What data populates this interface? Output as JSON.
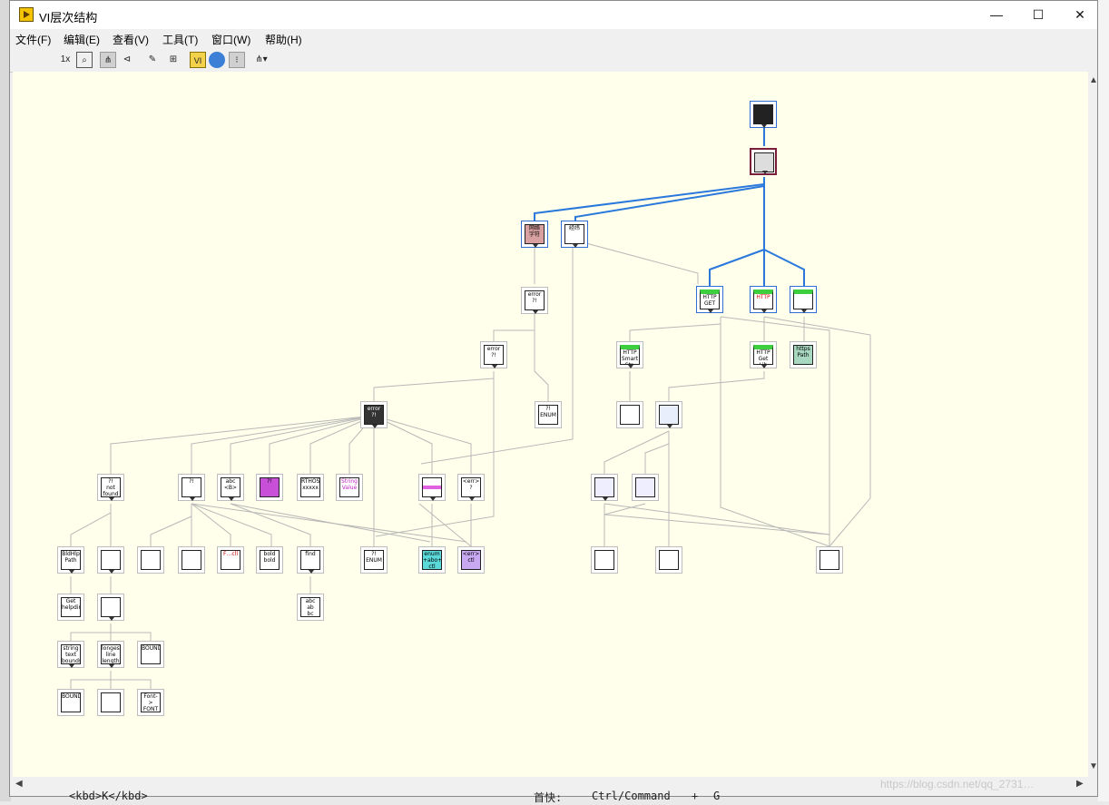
{
  "window": {
    "title": "VI层次结构",
    "controls": {
      "minimize": "—",
      "maximize": "☐",
      "close": "✕"
    }
  },
  "menu": [
    "文件(F)",
    "编辑(E)",
    "查看(V)",
    "工具(T)",
    "窗口(W)",
    "帮助(H)"
  ],
  "toolbar": {
    "zoom": "1x"
  },
  "nodes": {
    "n1": "",
    "n2": "",
    "n3": "网络\n字符",
    "n4": "经纬",
    "n5": "HTTP\nGET",
    "n6": "HTTP",
    "n7": "",
    "n8": "error\n?!",
    "n9": "error\n?!",
    "n10": "HTTP\nSmart\nStr->Pt",
    "n11": "HTTP\nGet\nLib",
    "n12": "https\nPath",
    "n13": "error\n?!",
    "n14": "?!\nENUM",
    "n15": "",
    "n16": "",
    "n17": "?!\nnot\nfound",
    "n18": "?!",
    "n19": "abc\n<B>",
    "n20": "?!",
    "n21": "RTHOST\nxxxxx",
    "n22": "String\nValue",
    "n23": "",
    "n24": "<err>\n?",
    "n25": "",
    "n26": "",
    "n27": "BldHlp\nPath",
    "n28": "",
    "n29": "",
    "n30": "",
    "n31": "F…cll",
    "n32": "bold\nbold",
    "n33": "find",
    "n34": "?!\nENUM",
    "n35": "enum\n+abo+\nctl",
    "n36": "<err>\nctl",
    "n37": "",
    "n38": "",
    "n39": "",
    "n40": "Get\nhelpdir",
    "n41": "",
    "n42": "abc\nab\nbc",
    "n43": "string\ntext\nbounds",
    "n44": "longest\nline\nlength",
    "n45": "BOUNDS",
    "n46": "BOUNDS",
    "n47": "",
    "n48": "Font->\nFONT"
  },
  "bottom_text": {
    "kbd": "<kbd>K</kbd>",
    "shortcut": "首快:",
    "ctrl": "Ctrl/Command",
    "plus": "+",
    "g": "G"
  },
  "watermark": "https://blog.csdn.net/qq_2731…"
}
